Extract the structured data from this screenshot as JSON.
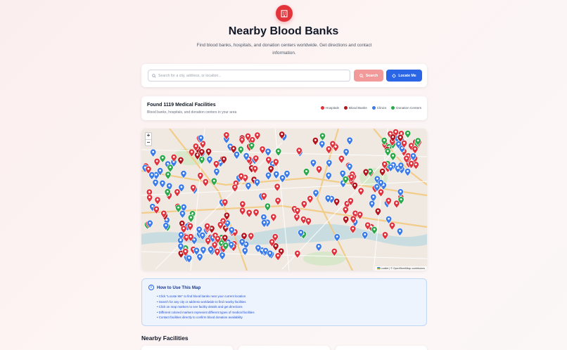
{
  "header": {
    "logo_icon": "hospital-building-icon",
    "title": "Nearby Blood Banks",
    "subtitle": "Find blood banks, hospitals, and donation centers worldwide. Get directions and contact information."
  },
  "search": {
    "placeholder": "Search for a city, address, or location...",
    "value": "",
    "search_label": "Search",
    "locate_label": "Locate Me"
  },
  "results": {
    "title": "Found 1119 Medical Facilities",
    "subtitle": "Blood banks, hospitals, and donation centers in your area",
    "legend": [
      {
        "label": "Hospitals",
        "color": "#e0323c"
      },
      {
        "label": "Blood Banks",
        "color": "#b3151d"
      },
      {
        "label": "Clinics",
        "color": "#3b7be8"
      },
      {
        "label": "Donation Centers",
        "color": "#2aa84a"
      }
    ]
  },
  "map": {
    "zoom_in": "+",
    "zoom_out": "−",
    "attribution": "🇺🇦 Leaflet | © OpenStreetMap contributors",
    "colors": {
      "hospital": "#e0323c",
      "blood_bank": "#b3151d",
      "clinic": "#3b7be8",
      "donation": "#2aa84a",
      "land": "#efe9e2",
      "road": "#f3c980",
      "water": "#aad3df",
      "park": "#cfe6c0"
    }
  },
  "howto": {
    "title": "How to Use This Map",
    "items": [
      "• Click \"Locate Me\" to find blood banks near your current location",
      "• Search for any city or address worldwide to find nearby facilities",
      "• Click on map markers to see facility details and get directions",
      "• Different colored markers represent different types of medical facilities",
      "• Contact facilities directly to confirm blood donation availability"
    ]
  },
  "facilities": {
    "title": "Nearby Facilities"
  }
}
